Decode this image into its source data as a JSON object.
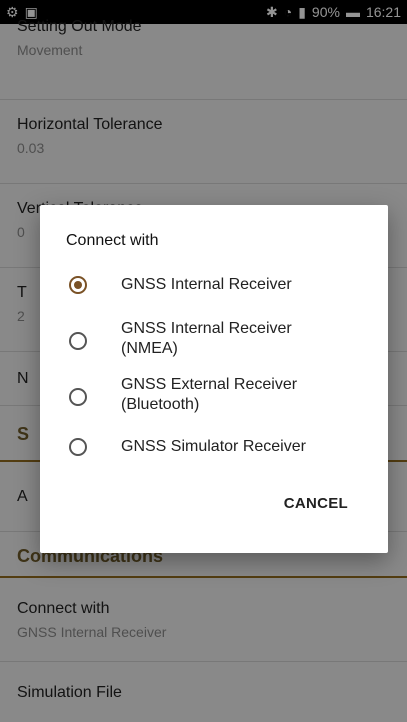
{
  "statusbar": {
    "time": "16:21",
    "battery": "90%"
  },
  "settings": {
    "items": [
      {
        "title": "Setting Out Mode",
        "subtitle": "Movement"
      },
      {
        "title": "Horizontal Tolerance",
        "subtitle": "0.03"
      },
      {
        "title": "Vertical Tolerance",
        "subtitle": "0"
      },
      {
        "title": "T",
        "subtitle": "2"
      },
      {
        "title": "N",
        "subtitle": ""
      }
    ],
    "section_s": "S",
    "item_a": "A",
    "section_comm": "Communications",
    "connect": {
      "title": "Connect with",
      "subtitle": "GNSS Internal Receiver"
    },
    "simulation": {
      "title": "Simulation File"
    }
  },
  "dialog": {
    "title": "Connect with",
    "options": [
      "GNSS Internal Receiver",
      "GNSS Internal Receiver (NMEA)",
      "GNSS External Receiver (Bluetooth)",
      "GNSS Simulator Receiver"
    ],
    "selected_index": 0,
    "cancel": "CANCEL"
  },
  "colors": {
    "accent": "#7a5226",
    "section_line": "#8f6a1e"
  }
}
